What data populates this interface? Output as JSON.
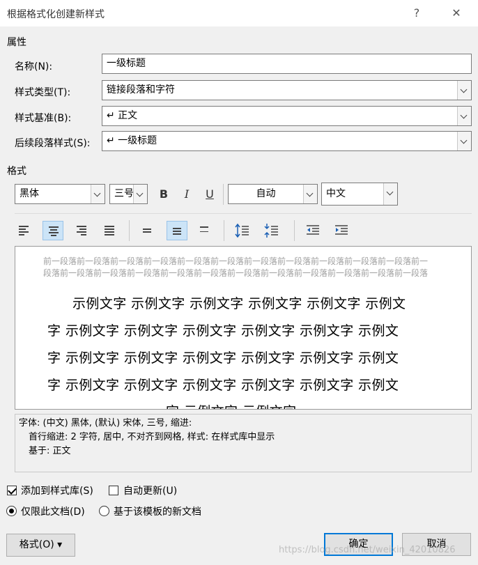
{
  "window": {
    "title": "根据格式化创建新样式",
    "help": "?",
    "close": "✕"
  },
  "properties": {
    "section": "属性",
    "name_label": "名称(N):",
    "name_value": "一级标题",
    "type_label": "样式类型(T):",
    "type_value": "链接段落和字符",
    "based_label": "样式基准(B):",
    "based_value": "↵ 正文",
    "next_label": "后续段落样式(S):",
    "next_value": "↵ 一级标题"
  },
  "format": {
    "section": "格式",
    "font": "黑体",
    "size": "三号",
    "bold": "B",
    "italic": "I",
    "underline": "U",
    "color": "自动",
    "script": "中文"
  },
  "preview": {
    "prev_paragraph": "前一段落前一段落前一段落前一段落前一段落前一段落前一段落前一段落前一段落前一段落前一段落前一段落前一段落前一段落前一段落前一段落前一段落前一段落前一段落前一段落前一段落前一段落前一段落",
    "line1": "示例文字  示例文字  示例文字  示例文字  示例文字  示例文",
    "line2": "字  示例文字  示例文字  示例文字  示例文字  示例文字  示例文",
    "line3": "字  示例文字  示例文字  示例文字  示例文字  示例文字  示例文",
    "line4": "字  示例文字  示例文字  示例文字  示例文字  示例文字  示例文",
    "line5": "字  示例文字  示例文字"
  },
  "description": {
    "line1": "字体: (中文) 黑体, (默认) 宋体, 三号, 缩进:",
    "line2": "首行缩进:  2 字符, 居中, 不对齐到网格, 样式: 在样式库中显示",
    "line3": "基于: 正文"
  },
  "options": {
    "add_gallery": "添加到样式库(S)",
    "auto_update": "自动更新(U)",
    "only_doc": "仅限此文档(D)",
    "new_docs": "基于该模板的新文档"
  },
  "buttons": {
    "format": "格式(O) ▾",
    "ok": "确定",
    "cancel": "取消"
  },
  "watermark": "https://blog.csdn.net/weixin_42010826",
  "colors": {
    "selected_align": "#cce4f7",
    "primary_border": "#0078d7"
  }
}
